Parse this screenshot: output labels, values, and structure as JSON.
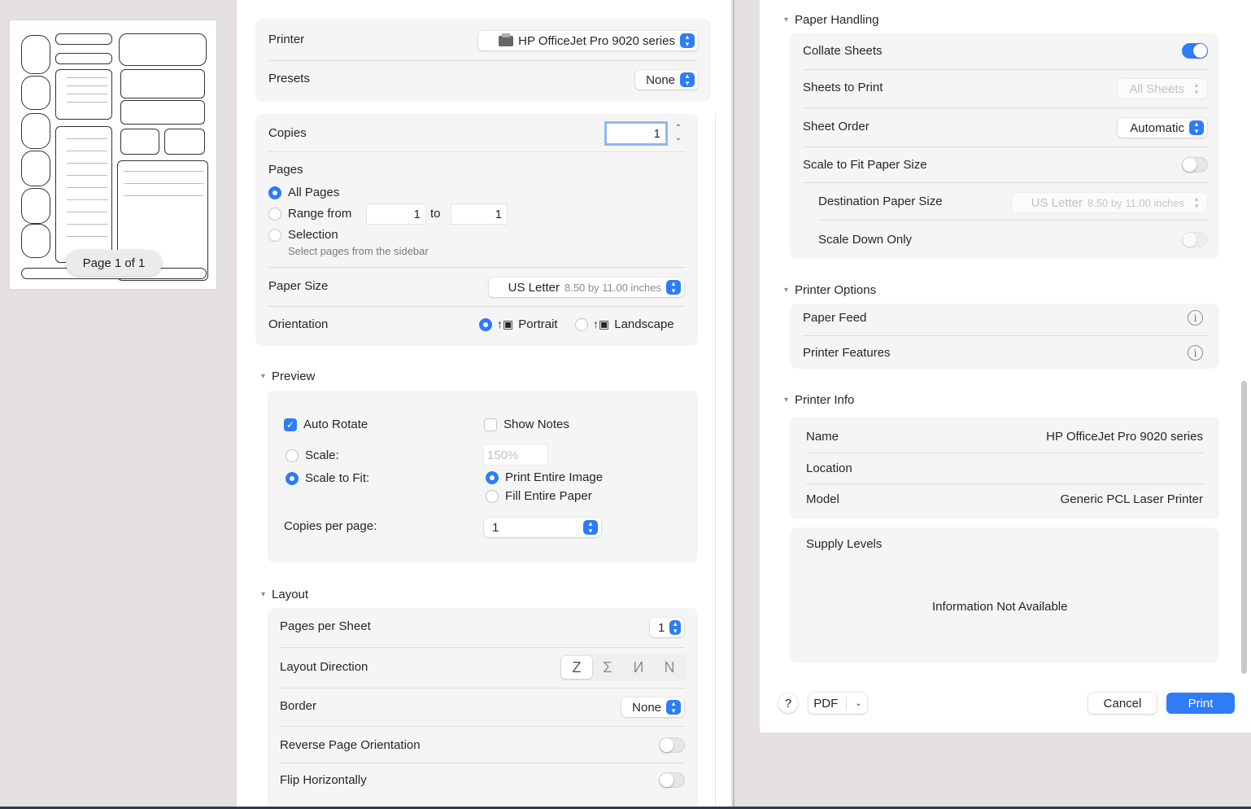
{
  "thumbnail": {
    "page_indicator": "Page 1 of 1"
  },
  "printer": {
    "label": "Printer",
    "value": "HP OfficeJet Pro 9020 series"
  },
  "presets": {
    "label": "Presets",
    "value": "None"
  },
  "copies": {
    "label": "Copies",
    "value": "1"
  },
  "pages": {
    "label": "Pages",
    "all": "All Pages",
    "range_from": "Range from",
    "range_start": "1",
    "to": "to",
    "range_end": "1",
    "selection": "Selection",
    "selection_hint": "Select pages from the sidebar"
  },
  "paper_size": {
    "label": "Paper Size",
    "value": "US Letter",
    "dims": "8.50 by 11.00 inches"
  },
  "orientation": {
    "label": "Orientation",
    "portrait": "Portrait",
    "landscape": "Landscape"
  },
  "preview": {
    "title": "Preview",
    "auto_rotate": "Auto Rotate",
    "show_notes": "Show Notes",
    "scale": "Scale:",
    "scale_value": "150%",
    "scale_to_fit": "Scale to Fit:",
    "print_entire_image": "Print Entire Image",
    "fill_entire_paper": "Fill Entire Paper",
    "copies_per_page": "Copies per page:",
    "copies_per_page_value": "1"
  },
  "layout": {
    "title": "Layout",
    "pages_per_sheet": "Pages per Sheet",
    "pages_per_sheet_value": "1",
    "layout_direction": "Layout Direction",
    "direction_glyphs": [
      "Z",
      "Σ",
      "И",
      "N"
    ],
    "border": "Border",
    "border_value": "None",
    "reverse_page_orientation": "Reverse Page Orientation",
    "flip_horizontally": "Flip Horizontally"
  },
  "paper_handling": {
    "title": "Paper Handling",
    "collate_sheets": "Collate Sheets",
    "sheets_to_print": "Sheets to Print",
    "sheets_to_print_value": "All Sheets",
    "sheet_order": "Sheet Order",
    "sheet_order_value": "Automatic",
    "scale_to_fit_paper": "Scale to Fit Paper Size",
    "destination_paper_size": "Destination Paper Size",
    "destination_value": "US Letter",
    "destination_dims": "8.50 by 11.00 inches",
    "scale_down_only": "Scale Down Only"
  },
  "printer_options": {
    "title": "Printer Options",
    "paper_feed": "Paper Feed",
    "printer_features": "Printer Features"
  },
  "printer_info": {
    "title": "Printer Info",
    "name_label": "Name",
    "name_value": "HP OfficeJet Pro 9020 series",
    "location_label": "Location",
    "location_value": "",
    "model_label": "Model",
    "model_value": "Generic PCL Laser Printer",
    "supply_levels": "Supply Levels",
    "supply_status": "Information Not Available"
  },
  "footer": {
    "help": "?",
    "pdf": "PDF",
    "cancel": "Cancel",
    "print": "Print"
  },
  "colors": {
    "accent": "#2e7cf6",
    "card_bg": "#f5f5f5",
    "window_bg": "#e3e0df"
  }
}
